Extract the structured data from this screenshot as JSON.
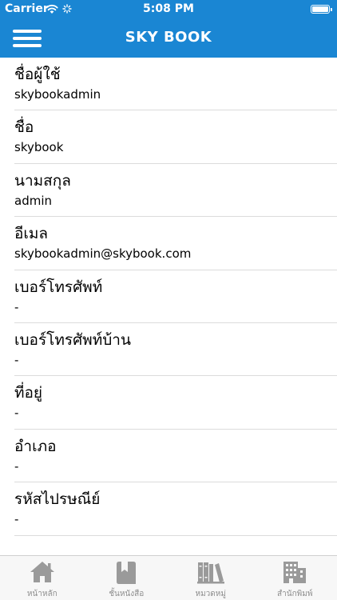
{
  "status_bar": {
    "carrier": "Carrier",
    "time": "5:08 PM"
  },
  "nav_bar": {
    "title": "SKY BOOK",
    "background_color": "#1A86D3",
    "menu_icon": "hamburger-menu-icon"
  },
  "profile": {
    "fields": [
      {
        "label": "ชื่อผู้ใช้",
        "value": "skybookadmin"
      },
      {
        "label": "ชื่อ",
        "value": "skybook"
      },
      {
        "label": "นามสกุล",
        "value": "admin"
      },
      {
        "label": "อีเมล",
        "value": "skybookadmin@skybook.com"
      },
      {
        "label": "เบอร์โทรศัพท์",
        "value": "-"
      },
      {
        "label": "เบอร์โทรศัพท์บ้าน",
        "value": "-"
      },
      {
        "label": "ที่อยู่",
        "value": "-"
      },
      {
        "label": "อำเภอ",
        "value": "-"
      },
      {
        "label": "รหัสไปรษณีย์",
        "value": "-"
      }
    ]
  },
  "tab_bar": {
    "icon_color": "#9a9a9a",
    "tabs": [
      {
        "label": "หน้าหลัก",
        "icon": "home-icon"
      },
      {
        "label": "ชั้นหนังสือ",
        "icon": "bookmark-book-icon"
      },
      {
        "label": "หมวดหมู่",
        "icon": "bookshelf-icon"
      },
      {
        "label": "สำนักพิมพ์",
        "icon": "building-icon"
      }
    ]
  }
}
